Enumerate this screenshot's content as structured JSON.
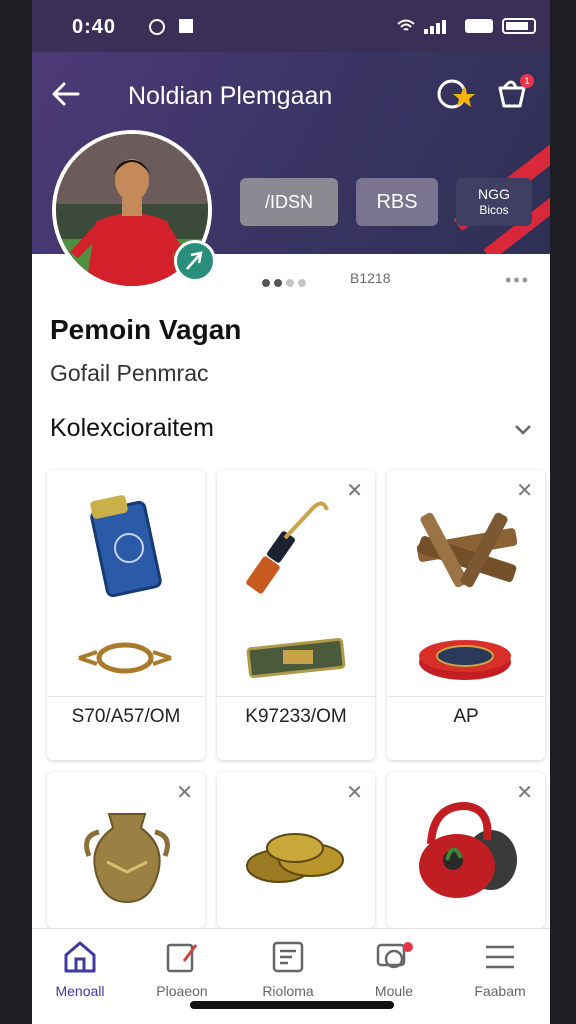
{
  "status_bar": {
    "time": "0:40"
  },
  "header": {
    "title": "Noldian Plemgaan",
    "notification_count": "1",
    "chips": [
      "/IDSN",
      "RBS",
      "NGG",
      "Bicos"
    ]
  },
  "profile": {
    "page_indicator": "B1218",
    "name": "Pemoin Vagan",
    "subtitle": "Gofail Penmrac"
  },
  "collection": {
    "title": "Kolexcioraitem",
    "cards": [
      {
        "label": "S70/A57/OM",
        "icon": "scroll-relic-icon",
        "secondary_icon": "bronze-ring-icon",
        "removable": false
      },
      {
        "label": "K97233/OM",
        "icon": "torch-icon",
        "secondary_icon": "ticket-icon",
        "removable": true
      },
      {
        "label": "AP",
        "icon": "log-bundle-icon",
        "secondary_icon": "red-disc-icon",
        "removable": true
      },
      {
        "label": "",
        "icon": "bronze-vase-icon",
        "removable": true
      },
      {
        "label": "",
        "icon": "gold-coins-icon",
        "removable": true
      },
      {
        "label": "",
        "icon": "red-kettle-icon",
        "removable": true
      }
    ]
  },
  "nav": [
    {
      "label": "Menoall",
      "icon": "home-icon",
      "active": true
    },
    {
      "label": "Ploaeon",
      "icon": "edit-icon",
      "active": false
    },
    {
      "label": "Rioloma",
      "icon": "list-card-icon",
      "active": false
    },
    {
      "label": "Moule",
      "icon": "chat-icon",
      "active": false
    },
    {
      "label": "Faabam",
      "icon": "menu-icon",
      "active": false
    }
  ],
  "colors": {
    "header": "#3c3566",
    "accent": "#3e3aa0",
    "stripe": "#d8283a",
    "badge": "#e5364c"
  }
}
